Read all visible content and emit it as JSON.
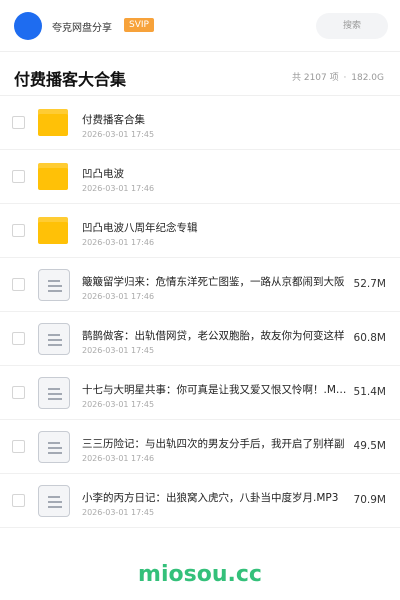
{
  "header": {
    "username": "夸克网盘分享",
    "badge": "SVIP",
    "search_placeholder": "搜索"
  },
  "title": {
    "text": "付费播客大合集",
    "summary_count": "共 2107 项",
    "summary_sep": "·",
    "summary_size": "182.0G"
  },
  "items": [
    {
      "type": "folder",
      "icon": "folder-icon",
      "name": "付费播客合集",
      "date": "2026-03-01 17:45",
      "size": ""
    },
    {
      "type": "folder",
      "icon": "folder-icon",
      "name": "凹凸电波",
      "date": "2026-03-01 17:46",
      "size": ""
    },
    {
      "type": "folder",
      "icon": "folder-icon",
      "name": "凹凸电波八周年纪念专辑",
      "date": "2026-03-01 17:46",
      "size": ""
    },
    {
      "type": "file",
      "icon": "document-icon",
      "name": "簸簸留学归来：危情东洋死亡图鉴，一路从京都闹到大阪",
      "date": "2026-03-01 17:46",
      "size": "52.7M"
    },
    {
      "type": "file",
      "icon": "document-icon",
      "name": "鹊鹊做客：出轨借网贷，老公双胞胎，故友你为何变这样",
      "date": "2026-03-01 17:45",
      "size": "60.8M"
    },
    {
      "type": "file",
      "icon": "document-icon",
      "name": "十七与大明星共事：你可真是让我又爱又恨又怜啊！.M…",
      "date": "2026-03-01 17:45",
      "size": "51.4M"
    },
    {
      "type": "file",
      "icon": "document-icon",
      "name": "三三历险记：与出轨四次的男友分手后，我开启了别样副",
      "date": "2026-03-01 17:46",
      "size": "49.5M"
    },
    {
      "type": "file",
      "icon": "document-icon",
      "name": "小李的丙方日记：出狼窝入虎穴，八卦当中度岁月.MP3",
      "date": "2026-03-01 17:45",
      "size": "70.9M"
    }
  ],
  "watermark": "miosou.cc",
  "colors": {
    "accent": "#1e6cf0",
    "svip": "#f7a23a",
    "folder": "#ffc107",
    "watermark": "#34c07a"
  }
}
